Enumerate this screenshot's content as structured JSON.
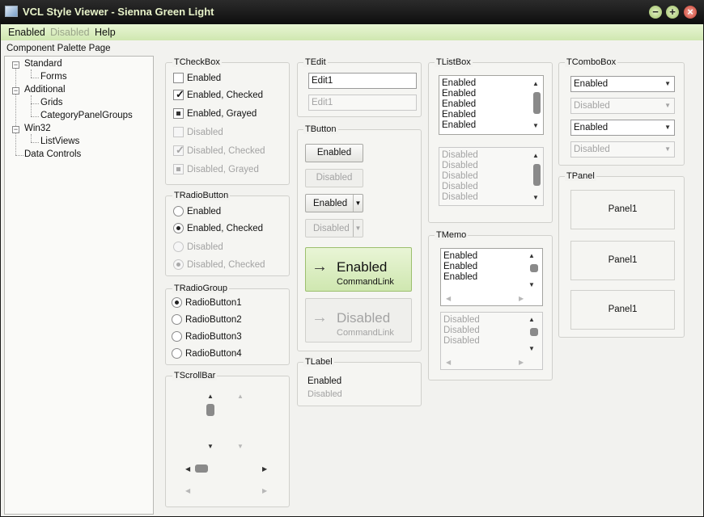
{
  "window": {
    "title": "VCL Style Viewer - Sienna Green Light"
  },
  "menu": {
    "enabled": "Enabled",
    "disabled": "Disabled",
    "help": "Help"
  },
  "palette_label": "Component Palette Page",
  "tree": {
    "standard": "Standard",
    "forms": "Forms",
    "additional": "Additional",
    "grids": "Grids",
    "category_panel_groups": "CategoryPanelGroups",
    "win32": "Win32",
    "listviews": "ListViews",
    "data_controls": "Data Controls"
  },
  "checkbox": {
    "group": "TCheckBox",
    "enabled": "Enabled",
    "enabled_checked": "Enabled, Checked",
    "enabled_grayed": "Enabled, Grayed",
    "disabled": "Disabled",
    "disabled_checked": "Disabled, Checked",
    "disabled_grayed": "Disabled, Grayed"
  },
  "radiobutton": {
    "group": "TRadioButton",
    "enabled": "Enabled",
    "enabled_checked": "Enabled, Checked",
    "disabled": "Disabled",
    "disabled_checked": "Disabled, Checked"
  },
  "radiogroup": {
    "group": "TRadioGroup",
    "items": [
      "RadioButton1",
      "RadioButton2",
      "RadioButton3",
      "RadioButton4"
    ]
  },
  "scrollbar": {
    "group": "TScrollBar"
  },
  "edit": {
    "group": "TEdit",
    "enabled_value": "Edit1",
    "disabled_value": "Edit1"
  },
  "button": {
    "group": "TButton",
    "enabled": "Enabled",
    "disabled": "Disabled",
    "split_enabled": "Enabled",
    "split_disabled": "Disabled",
    "cmd_enabled": "Enabled",
    "cmd_enabled_sub": "CommandLink",
    "cmd_disabled": "Disabled",
    "cmd_disabled_sub": "CommandLink"
  },
  "label": {
    "group": "TLabel",
    "enabled": "Enabled",
    "disabled": "Disabled"
  },
  "listbox": {
    "group": "TListBox",
    "enabled_items": [
      "Enabled",
      "Enabled",
      "Enabled",
      "Enabled",
      "Enabled"
    ],
    "disabled_items": [
      "Disabled",
      "Disabled",
      "Disabled",
      "Disabled",
      "Disabled"
    ]
  },
  "memo": {
    "group": "TMemo",
    "enabled_lines": [
      "Enabled",
      "Enabled",
      "Enabled"
    ],
    "disabled_lines": [
      "Disabled",
      "Disabled",
      "Disabled"
    ]
  },
  "combobox": {
    "group": "TComboBox",
    "enabled1": "Enabled",
    "disabled1": "Disabled",
    "enabled2": "Enabled",
    "disabled2": "Disabled"
  },
  "panel": {
    "group": "TPanel",
    "p1": "Panel1",
    "p2": "Panel1",
    "p3": "Panel1"
  },
  "colors": {
    "accent": "#cfe7b0",
    "title_text": "#e8f3c9",
    "close": "#c63c2d"
  }
}
